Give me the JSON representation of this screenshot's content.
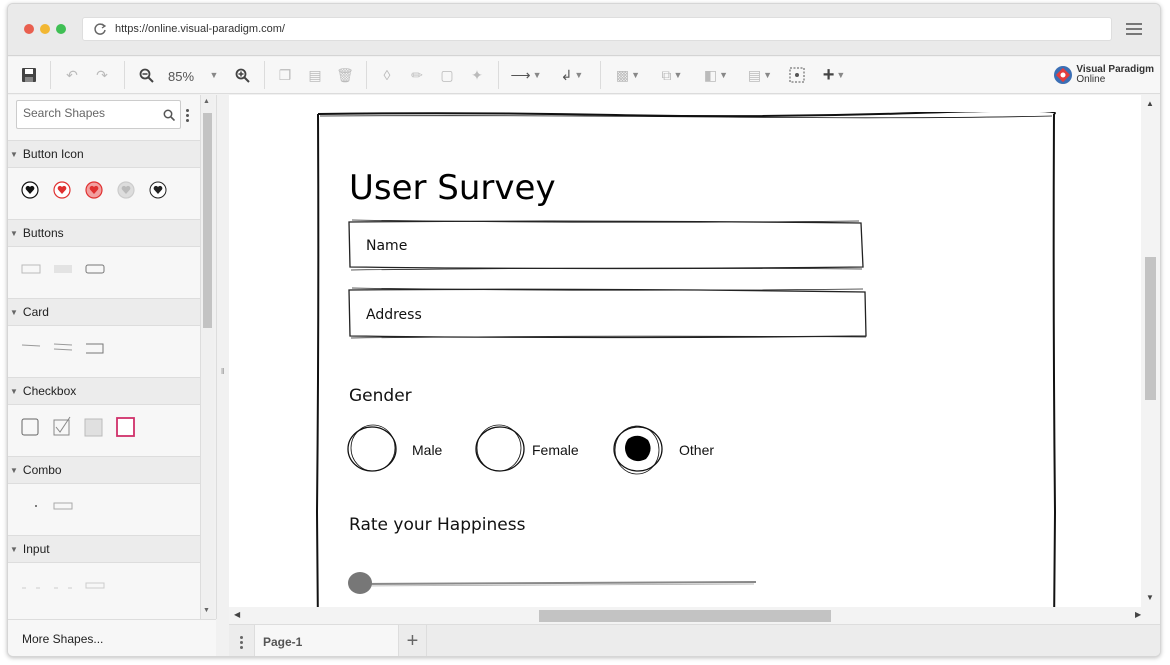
{
  "browser": {
    "url": "https://online.visual-paradigm.com/",
    "traffic_colors": [
      "#e95f4f",
      "#f2b733",
      "#3fbf54"
    ]
  },
  "toolbar": {
    "zoom": "85%",
    "logo_line1": "Visual Paradigm",
    "logo_line2": "Online"
  },
  "sidebar": {
    "search_placeholder": "Search Shapes",
    "categories": [
      {
        "label": "Button Icon"
      },
      {
        "label": "Buttons"
      },
      {
        "label": "Card"
      },
      {
        "label": "Checkbox"
      },
      {
        "label": "Combo"
      },
      {
        "label": "Input"
      }
    ],
    "more_shapes": "More Shapes..."
  },
  "pages": {
    "current": "Page-1"
  },
  "mockup": {
    "title": "User Survey",
    "name_placeholder": "Name",
    "address_placeholder": "Address",
    "gender_label": "Gender",
    "gender_options": [
      "Male",
      "Female",
      "Other"
    ],
    "selected_gender": "Other",
    "happiness_label": "Rate your Happiness",
    "happiness_value": 0
  }
}
